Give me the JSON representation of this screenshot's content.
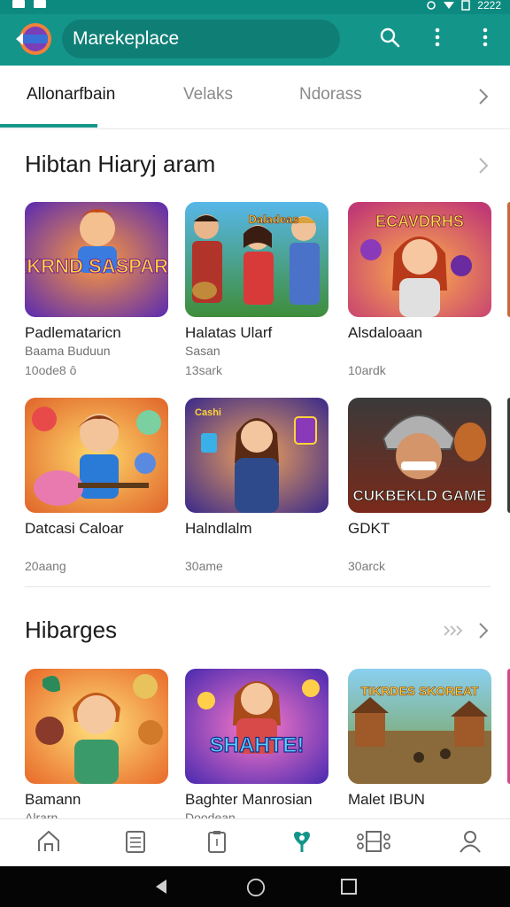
{
  "app_bar": {
    "title": "Marekeplace",
    "status_time": "2222"
  },
  "tabs": [
    {
      "label": "Allonarfbain",
      "active": true
    },
    {
      "label": "Velaks",
      "active": false
    },
    {
      "label": "Ndorass",
      "active": false
    }
  ],
  "sections": [
    {
      "title": "Hibtan  Hiaryj aram",
      "rows": [
        [
          {
            "title": "Padlemataricn",
            "subtitle": "Baama Buduun",
            "meta": "10ode8 ô"
          },
          {
            "title": "Halatas Ularf",
            "subtitle": "Sasan",
            "meta": "13sark"
          },
          {
            "title": "Alsdaloaan",
            "subtitle": "",
            "meta": "10ardk"
          }
        ],
        [
          {
            "title": "Datcasi Caloar",
            "subtitle": "",
            "meta": "20aang"
          },
          {
            "title": "Halndlalm",
            "subtitle": "",
            "meta": "30ame"
          },
          {
            "title": "GDKT",
            "subtitle": "",
            "meta": "30arck"
          }
        ]
      ],
      "thumb_texts": [
        "AKKRND SASPARES",
        "Daladeas",
        "ECAVDRHS",
        "",
        "Cashi",
        "CUKBEKLD GAME"
      ]
    },
    {
      "title": "Hibarges",
      "rows": [
        [
          {
            "title": "Bamann",
            "subtitle": "Alrarn",
            "meta": ""
          },
          {
            "title": "Baghter Manrosian",
            "subtitle": "Doodean",
            "meta": ""
          },
          {
            "title": "Malet IBUN",
            "subtitle": "",
            "meta": ""
          }
        ]
      ],
      "thumb_texts": [
        "",
        "SHAHTE!",
        "TIKRDES SKOREAT"
      ]
    }
  ],
  "bottom_nav": [
    "home-icon",
    "list-icon",
    "clipboard-icon",
    "heart-pin-icon",
    "settings-sliders-icon",
    "profile-icon"
  ],
  "colors": {
    "primary": "#14958a",
    "primary_dark": "#0d8a80",
    "active_nav": "#14958a"
  }
}
